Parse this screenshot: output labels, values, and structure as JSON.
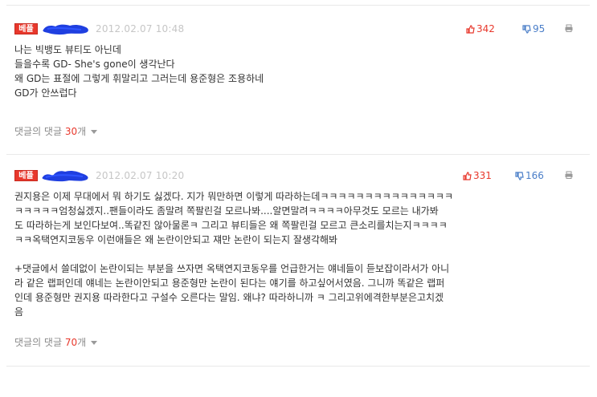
{
  "colors": {
    "badge": "#e8382c",
    "recommend": "#e8382c",
    "oppose": "#4a7ec8",
    "muted_text": "#c6c6c6",
    "nickname_scribble": "#1f3fe0"
  },
  "comments": [
    {
      "badge": "베플",
      "timestamp": "2012.02.07 10:48",
      "recommend_count": "342",
      "oppose_count": "95",
      "lines": [
        "나는 빅뱅도 뷰티도 아닌데",
        "들을수록 GD- She's gone이 생각난다",
        "왜 GD는 표절에 그렇게 휘말리고 그러는데 용준형은 조용하네",
        "GD가 안쓰럽다"
      ],
      "reply_label": "댓글의 댓글",
      "reply_count": "30",
      "reply_unit": "개"
    },
    {
      "badge": "베플",
      "timestamp": "2012.02.07 10:20",
      "recommend_count": "331",
      "oppose_count": "166",
      "lines": [
        "권지용은 이제 무대에서 뭐 하기도 싫겠다. 지가 뭐만하면 이렇게 따라하는데ㅋㅋㅋㅋㅋㅋㅋㅋㅋㅋㅋㅋㅋㅋㅋ",
        "ㅋㅋㅋㅋㅋ엄청싫겠지..팬들이라도 좀말려 쪽팔린걸 모르나봐....알면말려ㅋㅋㅋㅋ아무것도 모르는 내가봐",
        "도 따라하는게 보인다보여..똑같진 않아물론ㅋ 그리고 뷰티들은 왜 쪽팔린걸 모르고 큰소리를치는지ㅋㅋㅋㅋ",
        "ㅋㅋ옥택연지코동우 이런애들은 왜 논란이안되고 쟤만 논란이 되는지 잘생각해봐",
        "",
        "+댓글에서 쓸데없이 논란이되는 부분을 쓰자면 옥택연지코동우를 언급한거는 얘네들이 듣보잡이라서가 아니",
        "라 같은 랩퍼인데 얘네는 논란이안되고 용준형만 논란이 된다는 얘기를 하고싶어서였음. 그니까 똑같은 랩퍼",
        "인데 용준형만 권지용 따라한다고 구설수 오른다는 말임. 왜냐? 따라하니까 ㅋ 그리고위에격한부분은고치겠",
        "음"
      ],
      "reply_label": "댓글의 댓글",
      "reply_count": "70",
      "reply_unit": "개"
    }
  ]
}
